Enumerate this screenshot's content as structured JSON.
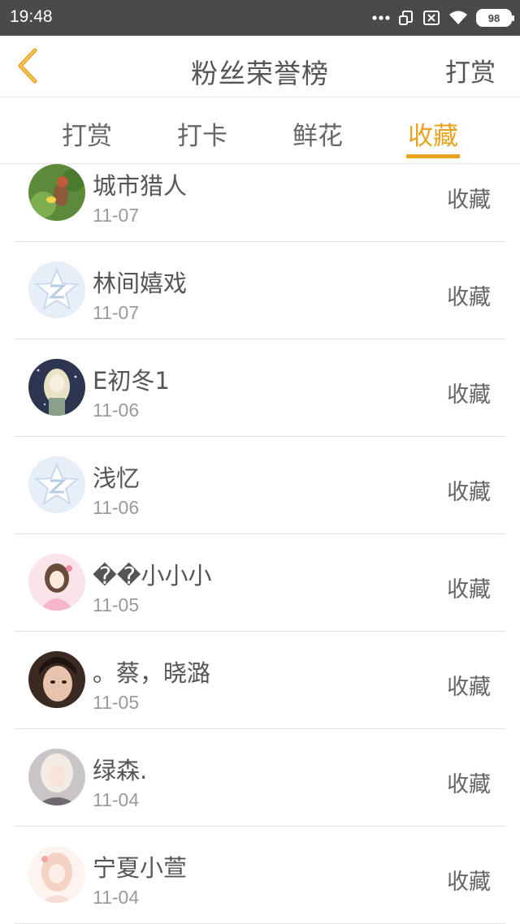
{
  "status_bar": {
    "time": "19:48",
    "battery": "98"
  },
  "header": {
    "title": "粉丝荣誉榜",
    "right_link": "打赏"
  },
  "tabs": [
    {
      "label": "打赏"
    },
    {
      "label": "打卡"
    },
    {
      "label": "鲜花"
    },
    {
      "label": "收藏"
    }
  ],
  "active_tab_color": "#e9a31e",
  "fans": [
    {
      "name": "城市猎人",
      "date": "11-07",
      "action": "收藏",
      "avatar": "game-character-avatar"
    },
    {
      "name": "林间嬉戏",
      "date": "11-07",
      "action": "收藏",
      "avatar": "default-star-avatar"
    },
    {
      "name": "E初冬1",
      "date": "11-06",
      "action": "收藏",
      "avatar": "anime-girl-avatar"
    },
    {
      "name": "浅忆",
      "date": "11-06",
      "action": "收藏",
      "avatar": "default-star-avatar"
    },
    {
      "name": "��小小小",
      "date": "11-05",
      "action": "收藏",
      "avatar": "pink-doll-avatar"
    },
    {
      "name": "。蔡，晓潞",
      "date": "11-05",
      "action": "收藏",
      "avatar": "photo-girl-avatar"
    },
    {
      "name": "绿森.",
      "date": "11-04",
      "action": "收藏",
      "avatar": "blonde-girl-avatar"
    },
    {
      "name": "宁夏小萱",
      "date": "11-04",
      "action": "收藏",
      "avatar": "anime-pink-avatar"
    }
  ]
}
